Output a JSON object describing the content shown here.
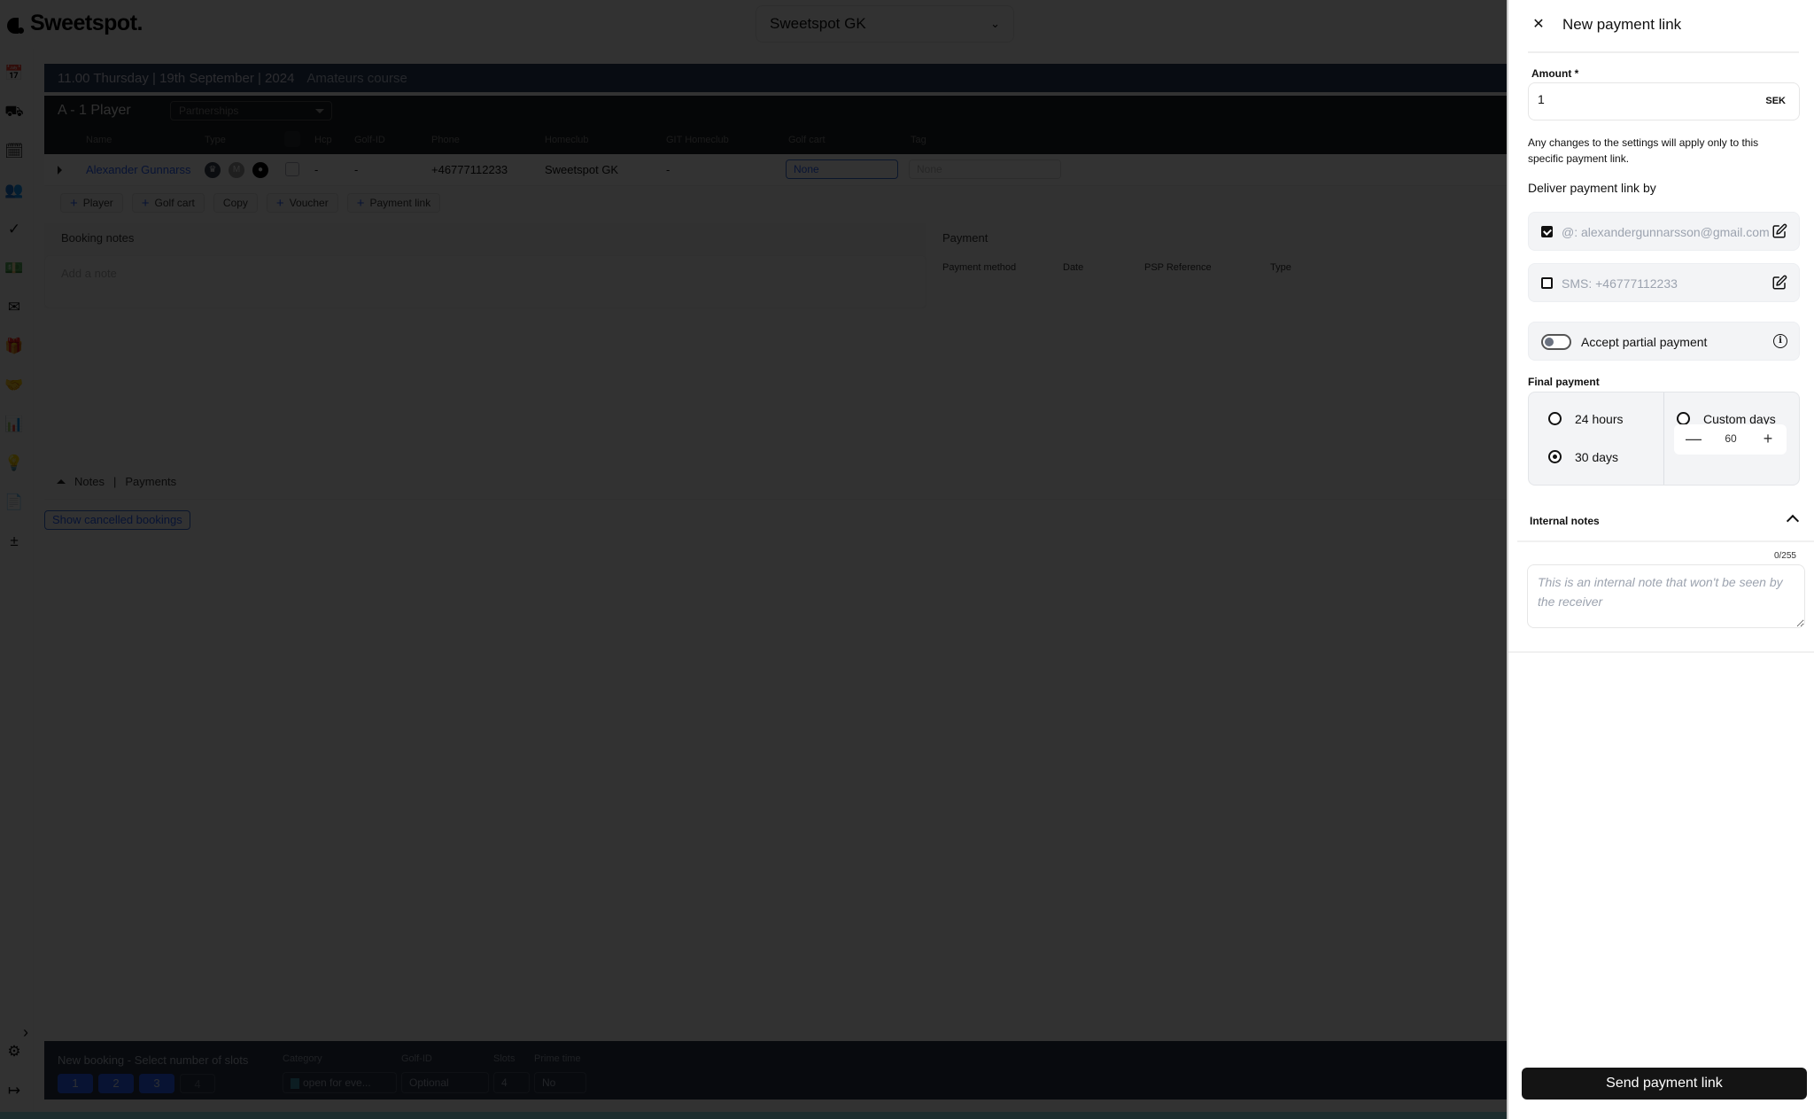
{
  "app": {
    "brand": "Sweetspot.",
    "club_selector": "Sweetspot GK",
    "sidebar_icons": [
      "tee-sheet-icon",
      "golf-cart-icon",
      "calendar-check-icon",
      "members-icon",
      "verified-badge-icon",
      "payments-icon",
      "mail-icon",
      "gift-icon",
      "partnership-icon",
      "bar-chart-icon",
      "lightbulb-icon",
      "report-icon",
      "calculator-icon"
    ],
    "sidebar_bottom_icons": [
      "settings-icon",
      "logout-icon"
    ]
  },
  "booking": {
    "slot_header": "11.00 Thursday | 19th September | 2024",
    "course": "Amateurs course",
    "group_title": "A - 1 Player",
    "partnerships_placeholder": "Partnerships",
    "columns": [
      "Name",
      "Type",
      "Hcp",
      "Golf-ID",
      "Phone",
      "Homeclub",
      "GIT Homeclub",
      "Golf cart",
      "Tag"
    ],
    "player": {
      "name": "Alexander Gunnarss",
      "type_badges": [
        "crown-badge-icon",
        "M",
        "sweetspot-badge-icon"
      ],
      "hcp": "-",
      "golf_id": "-",
      "phone": "+46777112233",
      "homeclub": "Sweetspot GK",
      "git_homeclub": "-",
      "golf_cart": "None",
      "tag_placeholder": "None"
    },
    "actions": [
      {
        "label": "Player",
        "plus": true
      },
      {
        "label": "Golf cart",
        "plus": true
      },
      {
        "label": "Copy",
        "plus": false
      },
      {
        "label": "Voucher",
        "plus": true
      },
      {
        "label": "Payment link",
        "plus": true
      }
    ],
    "booking_notes_label": "Booking notes",
    "note_placeholder": "Add a note",
    "payment_label": "Payment",
    "payment_columns": [
      "Payment method",
      "Date",
      "PSP Reference",
      "Type"
    ],
    "tabs": [
      "Notes",
      "|",
      "Payments"
    ],
    "show_cancelled": "Show cancelled bookings"
  },
  "new_booking": {
    "title": "New booking - Select number of slots",
    "slots": [
      "1",
      "2",
      "3",
      "4"
    ],
    "category_label": "Category",
    "category_value": "open for eve...",
    "golf_id_label": "Golf-ID",
    "golf_id_value": "Optional",
    "slots_label": "Slots",
    "slots_value": "4",
    "prime_label": "Prime time",
    "prime_value": "No"
  },
  "drawer": {
    "title": "New payment link",
    "amount_label": "Amount *",
    "amount_value": "1",
    "currency": "SEK",
    "hint": "Any changes to the settings will apply only to this specific payment link.",
    "deliver_label": "Deliver payment link by",
    "email": {
      "text": "@: alexandergunnarsson@gmail.com",
      "checked": true
    },
    "sms": {
      "text": "SMS: +46777112233",
      "checked": false
    },
    "partial_label": "Accept partial payment",
    "partial_enabled": false,
    "final_label": "Final payment",
    "options": {
      "h24": "24 hours",
      "d30": "30 days",
      "custom": "Custom days"
    },
    "selected_option": "30 days",
    "custom_days": "60",
    "internal_notes_label": "Internal notes",
    "counter": "0/255",
    "notes_placeholder": "This is an internal note that won't be seen by the receiver",
    "send_label": "Send payment link"
  },
  "colors": {
    "accent": "#2962ff",
    "send_button": "#141414",
    "overlay": "rgba(0,0,0,0.8)"
  }
}
